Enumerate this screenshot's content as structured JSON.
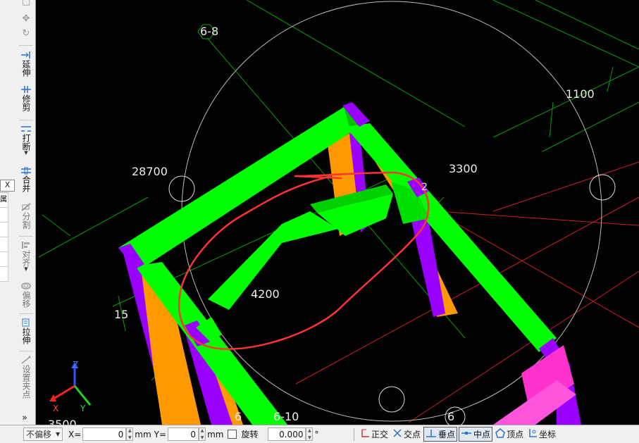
{
  "left_panel": {
    "close_label": "X",
    "grid_text": "属"
  },
  "toolbar": {
    "top_icons": [
      "rotate-icon",
      "move-icon",
      "undo-icon"
    ],
    "tools": [
      {
        "id": "extend",
        "label": "延伸",
        "icon": "extend-icon",
        "enabled": true
      },
      {
        "id": "trim",
        "label": "修剪",
        "icon": "trim-icon",
        "enabled": true
      },
      {
        "id": "break",
        "label": "打断",
        "icon": "break-icon",
        "enabled": true,
        "dropdown": true
      },
      {
        "id": "merge",
        "label": "合并",
        "icon": "merge-icon",
        "enabled": true
      },
      {
        "id": "split",
        "label": "分割",
        "icon": "split-icon",
        "enabled": false
      },
      {
        "id": "align",
        "label": "对齐",
        "icon": "align-icon",
        "enabled": false,
        "dropdown": true
      },
      {
        "id": "offset",
        "label": "偏移",
        "icon": "offset-icon",
        "enabled": false
      },
      {
        "id": "stretch",
        "label": "拉伸",
        "icon": "stretch-icon",
        "enabled": true
      },
      {
        "id": "grip",
        "label": "设置夹点",
        "icon": "grip-icon",
        "enabled": false
      }
    ],
    "more": "»"
  },
  "viewport": {
    "dim_labels": {
      "d28700": "28700",
      "d3300": "3300",
      "d1100": "1100",
      "d4200": "4200",
      "d15": "15",
      "d3500": "3500",
      "d2": "2"
    },
    "axis_labels": {
      "a68": "6-8",
      "a610": "6-10",
      "a6a": "6",
      "a6b": "6"
    },
    "gizmo": {
      "x": "X",
      "y": "Y",
      "z": "Z"
    },
    "colors": {
      "beam_green": "#00ff00",
      "beam_green_dark": "#00c000",
      "purple": "#9900ff",
      "orange": "#ff9900",
      "magenta": "#ff33cc",
      "annotation_red": "#ff3333",
      "axis_green": "#00aa00",
      "circle_white": "#ffffff"
    }
  },
  "statusbar": {
    "offset_mode": "不偏移",
    "x_label": "X=",
    "x_value": "0",
    "x_unit": "mm",
    "y_label": "Y=",
    "y_value": "0",
    "y_unit": "mm",
    "rotate_label": "旋转",
    "rotate_value": "0.000",
    "degree": "°",
    "snaps": [
      {
        "label": "正交",
        "icon": "orthogonal-icon",
        "active": false
      },
      {
        "label": "交点",
        "icon": "intersection-icon",
        "active": false
      },
      {
        "label": "垂点",
        "icon": "perpendicular-icon",
        "active": true
      },
      {
        "label": "中点",
        "icon": "midpoint-icon",
        "active": true
      },
      {
        "label": "顶点",
        "icon": "vertex-icon",
        "active": false
      },
      {
        "label": "坐标",
        "icon": "coordinate-icon",
        "active": false
      }
    ]
  }
}
